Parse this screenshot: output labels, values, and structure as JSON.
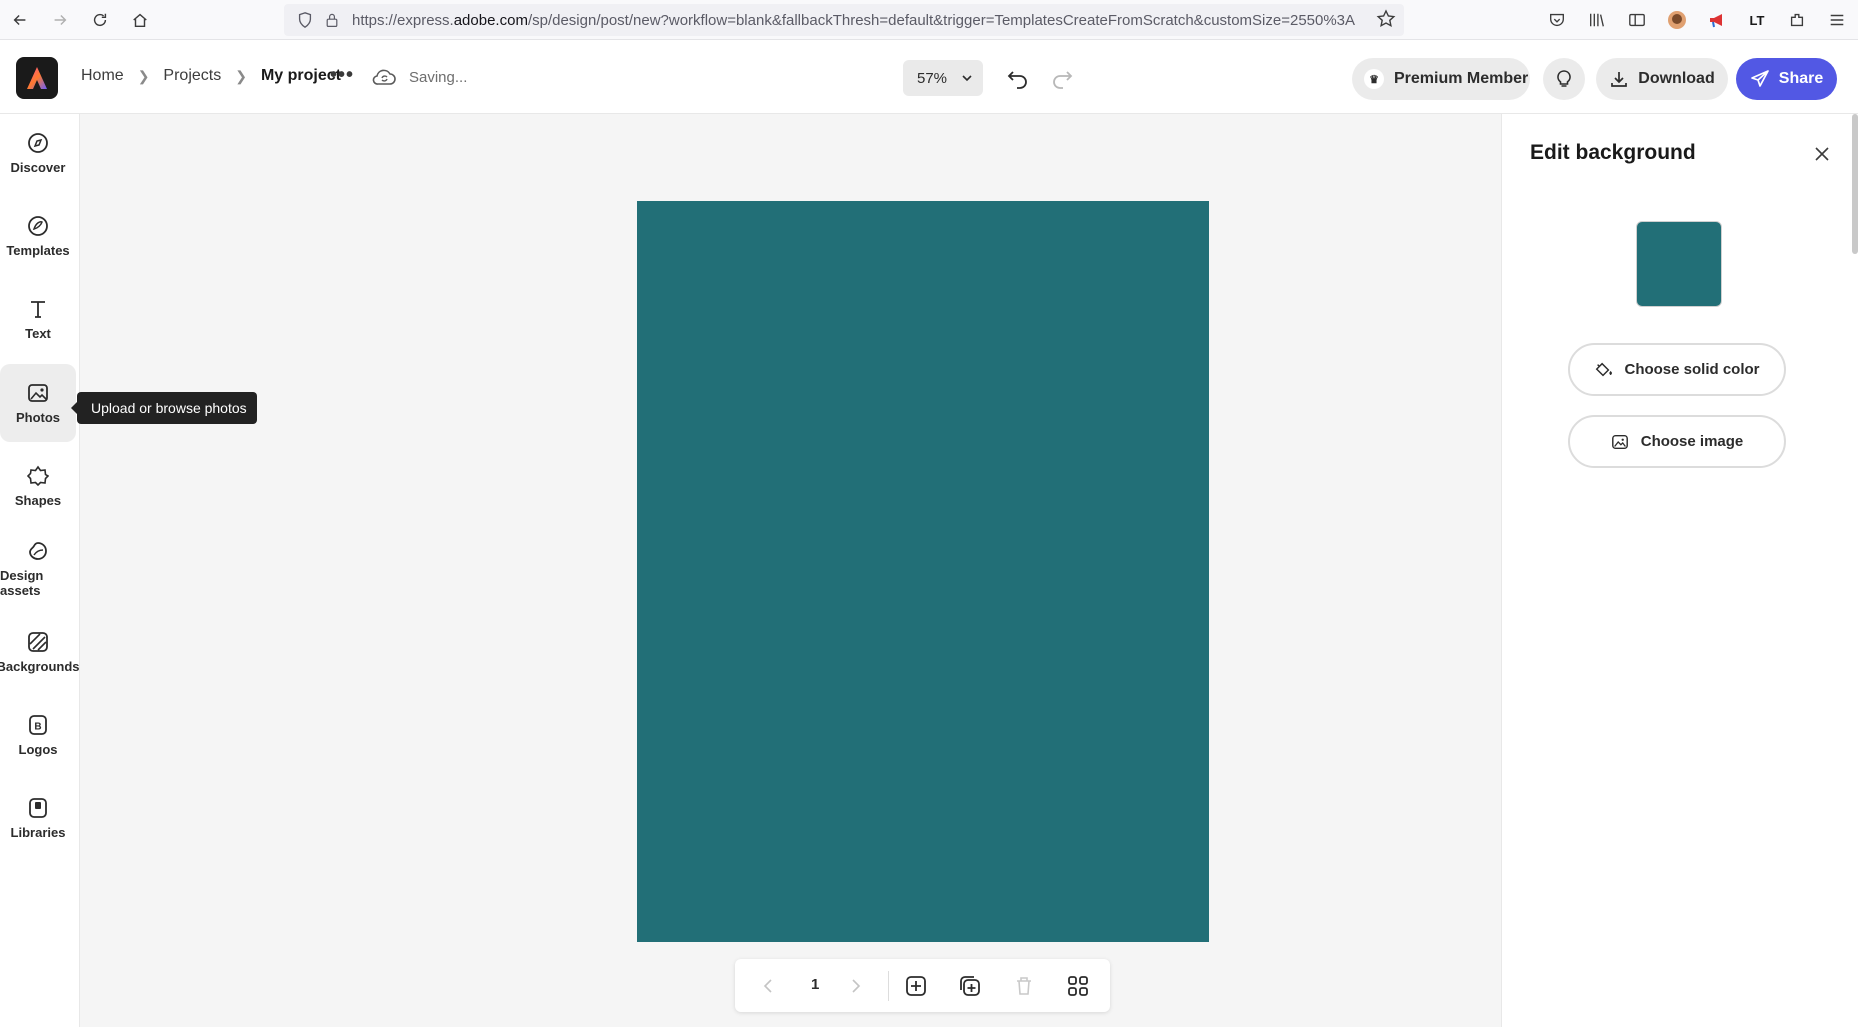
{
  "browser": {
    "url_prefix": "https://express.",
    "url_domain": "adobe.com",
    "url_rest": "/sp/design/post/new?workflow=blank&fallbackThresh=default&trigger=TemplatesCreateFromScratch&customSize=2550%3A"
  },
  "header": {
    "breadcrumbs": [
      "Home",
      "Projects",
      "My project"
    ],
    "status": "Saving...",
    "zoom": "57%",
    "premium_label": "Premium Member",
    "download_label": "Download",
    "share_label": "Share"
  },
  "rail": {
    "items": [
      {
        "label": "Discover",
        "icon": "compass-icon"
      },
      {
        "label": "Templates",
        "icon": "templates-icon"
      },
      {
        "label": "Text",
        "icon": "text-icon"
      },
      {
        "label": "Photos",
        "icon": "photo-icon"
      },
      {
        "label": "Shapes",
        "icon": "shapes-icon"
      },
      {
        "label": "Design assets",
        "icon": "design-assets-icon"
      },
      {
        "label": "Backgrounds",
        "icon": "backgrounds-icon"
      },
      {
        "label": "Logos",
        "icon": "logos-icon"
      },
      {
        "label": "Libraries",
        "icon": "libraries-icon"
      }
    ],
    "active": "Photos",
    "tooltip": "Upload or browse photos"
  },
  "canvas": {
    "background_color": "#226f77"
  },
  "pager": {
    "current_page": "1"
  },
  "panel": {
    "title": "Edit background",
    "swatch_color": "#226f77",
    "solid_color_label": "Choose solid color",
    "image_label": "Choose image"
  },
  "colors": {
    "accent": "#5258e4",
    "canvas": "#226f77"
  }
}
